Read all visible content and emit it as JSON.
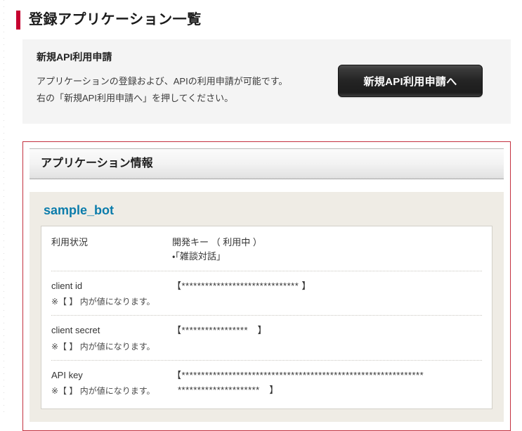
{
  "page": {
    "title": "登録アプリケーション一覧",
    "accent_color": "#c60030"
  },
  "notice": {
    "heading": "新規API利用申請",
    "line1": "アプリケーションの登録および、APIの利用申請が可能です。",
    "line2": "右の「新規API利用申請へ」を押してください。",
    "button_label": "新規API利用申請へ"
  },
  "app_info": {
    "section_title": "アプリケーション情報",
    "border_color": "#c3303f",
    "app_name": "sample_bot",
    "app_name_color": "#0b7cab",
    "rows": [
      {
        "label": "利用状況",
        "value": "開発キー （ 利用中 ）",
        "value_sub": "・「雑談対話」",
        "note": ""
      },
      {
        "label": "client id",
        "value": "【******************************                】",
        "note": "※【 】 内が値になります。"
      },
      {
        "label": "client secret",
        "value": "【*****************　】",
        "note": "※【 】 内が値になります。"
      },
      {
        "label": "API key",
        "value": "【**************************************************************",
        "note": "※【 】 内が値になります。",
        "note_trail": "*********************　】"
      }
    ]
  }
}
